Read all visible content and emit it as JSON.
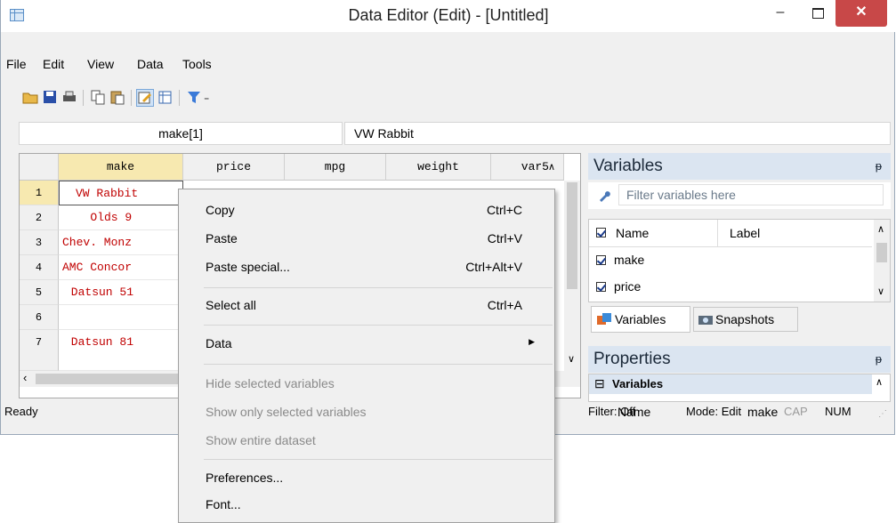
{
  "window": {
    "title": "Data Editor (Edit) - [Untitled]",
    "min_glyph": "–",
    "close_glyph": "✕"
  },
  "menu": [
    "File",
    "Edit",
    "View",
    "Data",
    "Tools"
  ],
  "toolbar": {
    "filter_dropdown_glyph": "₌"
  },
  "namebar": {
    "cell_ref": "make[1]",
    "cell_value": "VW Rabbit"
  },
  "grid": {
    "columns": [
      "make",
      "price",
      "mpg",
      "weight",
      "var5"
    ],
    "rows": [
      {
        "n": "1",
        "make": "VW Rabbit"
      },
      {
        "n": "2",
        "make": "   Olds 9"
      },
      {
        "n": "3",
        "make": "Chev. Monz"
      },
      {
        "n": "4",
        "make": "AMC Concor"
      },
      {
        "n": "5",
        "make": " Datsun 51"
      },
      {
        "n": "6",
        "make": ""
      },
      {
        "n": "7",
        "make": " Datsun 81"
      }
    ]
  },
  "context_menu": {
    "copy": "Copy",
    "copy_sc": "Ctrl+C",
    "paste": "Paste",
    "paste_sc": "Ctrl+V",
    "paste_special": "Paste special...",
    "paste_special_sc": "Ctrl+Alt+V",
    "select_all": "Select all",
    "select_all_sc": "Ctrl+A",
    "data": "Data",
    "hide_selected": "Hide selected variables",
    "show_only_selected": "Show only selected variables",
    "show_entire": "Show entire dataset",
    "preferences": "Preferences...",
    "font": "Font..."
  },
  "variables_panel": {
    "title": "Variables",
    "filter_placeholder": "Filter variables here",
    "col_name": "Name",
    "col_label": "Label",
    "items": [
      "make",
      "price"
    ],
    "tab_variables": "Variables",
    "tab_snapshots": "Snapshots"
  },
  "properties_panel": {
    "title": "Properties",
    "group": "Variables",
    "group_toggle": "⊟",
    "prop_name": "Name",
    "prop_value": "make"
  },
  "status": {
    "ready": "Ready",
    "filter": "Filter: Off",
    "mode": "Mode: Edit",
    "cap": "CAP",
    "num": "NUM"
  },
  "colors": {
    "accent": "#c84848",
    "cell_text": "#c00000",
    "panel_header": "#dbe5f1"
  }
}
